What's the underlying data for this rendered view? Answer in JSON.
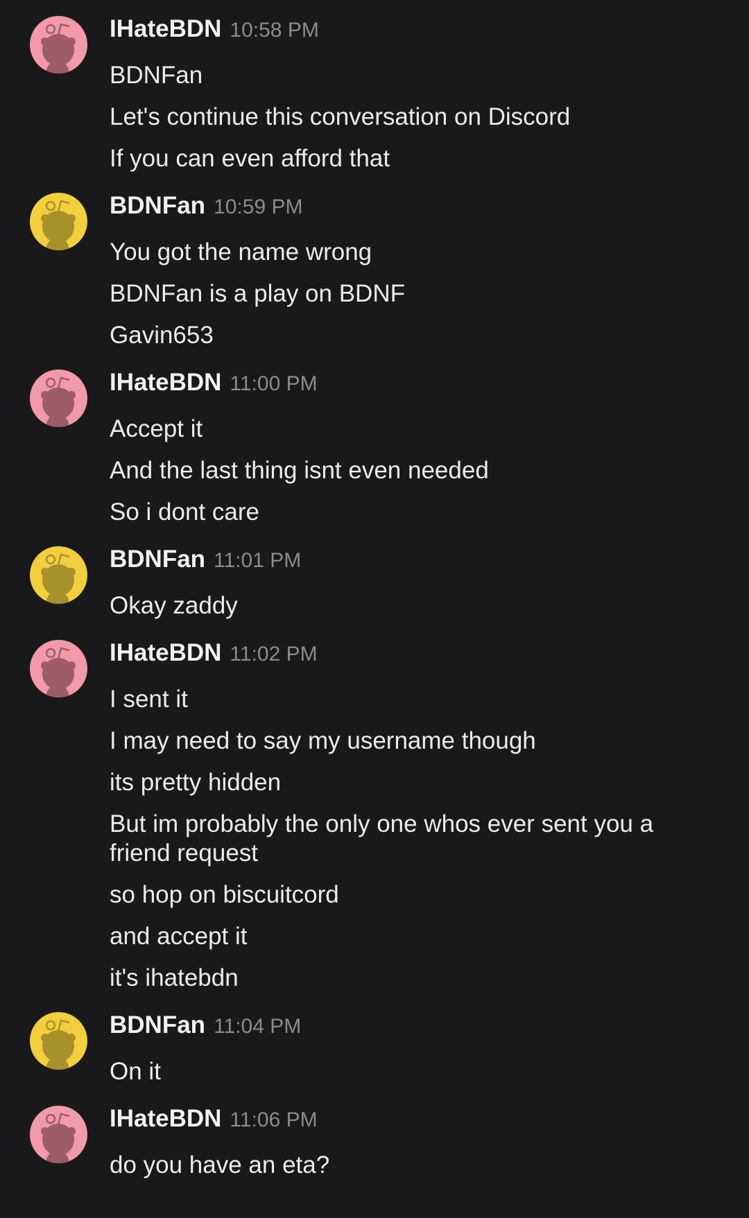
{
  "colors": {
    "background": "#19191b",
    "avatar_pink": "#f29aa8",
    "avatar_yellow": "#f3cf3d"
  },
  "messages": [
    {
      "author": "IHateBDN",
      "time": "10:58 PM",
      "avatar": "snoo-pink-icon",
      "lines": [
        "BDNFan",
        "Let's continue this conversation on Discord",
        "If you can even afford that"
      ]
    },
    {
      "author": "BDNFan",
      "time": "10:59 PM",
      "avatar": "snoo-yellow-icon",
      "lines": [
        "You got the name wrong",
        "BDNFan is a play on BDNF",
        "Gavin653"
      ]
    },
    {
      "author": "IHateBDN",
      "time": "11:00 PM",
      "avatar": "snoo-pink-icon",
      "lines": [
        "Accept it",
        "And the last thing isnt even needed",
        "So i dont care"
      ]
    },
    {
      "author": "BDNFan",
      "time": "11:01 PM",
      "avatar": "snoo-yellow-icon",
      "lines": [
        "Okay zaddy"
      ]
    },
    {
      "author": "IHateBDN",
      "time": "11:02 PM",
      "avatar": "snoo-pink-icon",
      "lines": [
        "I sent it",
        "I may need to say my username though",
        "its pretty hidden",
        "But im probably the only one whos ever sent you a friend request",
        "so hop on biscuitcord",
        "and accept it",
        "it's ihatebdn"
      ]
    },
    {
      "author": "BDNFan",
      "time": "11:04 PM",
      "avatar": "snoo-yellow-icon",
      "lines": [
        "On it"
      ]
    },
    {
      "author": "IHateBDN",
      "time": "11:06 PM",
      "avatar": "snoo-pink-icon",
      "lines": [
        "do you have an eta?"
      ]
    }
  ]
}
